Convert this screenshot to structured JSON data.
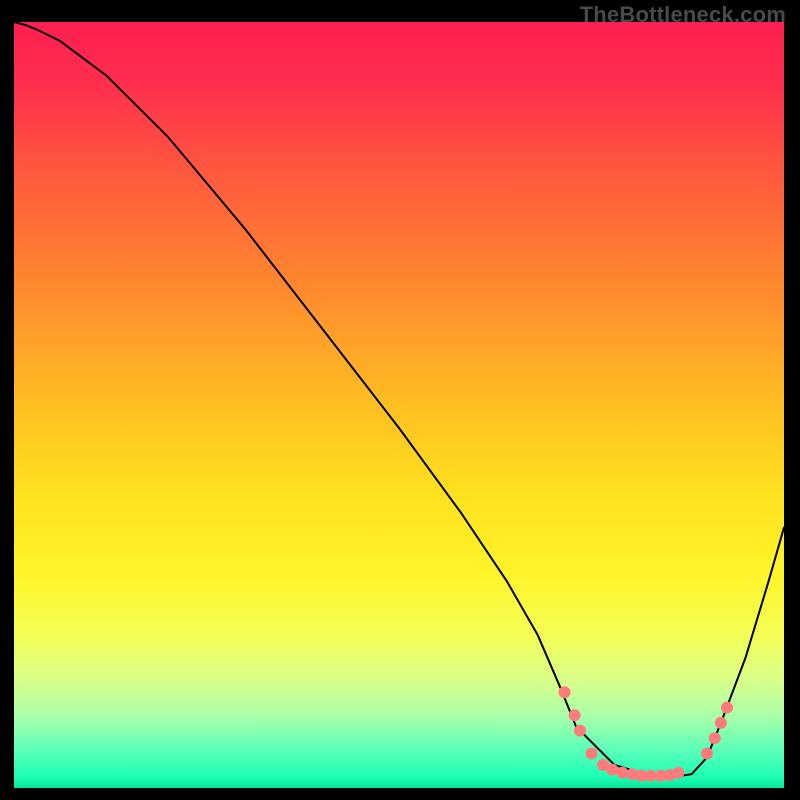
{
  "watermark": "TheBottleneck.com",
  "chart_data": {
    "type": "line",
    "title": "",
    "xlabel": "",
    "ylabel": "",
    "xlim": [
      0,
      100
    ],
    "ylim": [
      0,
      100
    ],
    "grid": false,
    "legend": false,
    "background": {
      "type": "vertical-gradient",
      "stops": [
        {
          "offset": 0,
          "color": "#ff1f52"
        },
        {
          "offset": 0.08,
          "color": "#ff2e4d"
        },
        {
          "offset": 0.2,
          "color": "#ff5a3d"
        },
        {
          "offset": 0.35,
          "color": "#ff8a2e"
        },
        {
          "offset": 0.5,
          "color": "#ffbf22"
        },
        {
          "offset": 0.63,
          "color": "#ffe41f"
        },
        {
          "offset": 0.72,
          "color": "#fff429"
        },
        {
          "offset": 0.8,
          "color": "#f4ff55"
        },
        {
          "offset": 0.86,
          "color": "#d9ff8a"
        },
        {
          "offset": 0.91,
          "color": "#a4ffab"
        },
        {
          "offset": 0.95,
          "color": "#5bffb8"
        },
        {
          "offset": 0.985,
          "color": "#1effb6"
        },
        {
          "offset": 1.0,
          "color": "#06e79a"
        }
      ]
    },
    "series": [
      {
        "name": "bottleneck-curve",
        "color": "#000000",
        "x": [
          0,
          1.5,
          3,
          6,
          12,
          20,
          30,
          40,
          50,
          58,
          64,
          68,
          71,
          73,
          78,
          83,
          86,
          88,
          90,
          92,
          95,
          98,
          100
        ],
        "y": [
          100,
          99.6,
          99,
          97.5,
          93,
          85,
          73,
          60,
          47,
          36,
          27,
          20,
          13,
          8,
          3,
          1.5,
          1.5,
          1.8,
          4,
          9,
          17,
          27,
          34
        ]
      }
    ],
    "markers": {
      "name": "threshold-dots",
      "color": "#ff7a7a",
      "radius": 6,
      "points_xy": [
        [
          71.5,
          12.5
        ],
        [
          72.8,
          9.5
        ],
        [
          73.5,
          7.5
        ],
        [
          75.0,
          4.5
        ],
        [
          76.5,
          3.0
        ],
        [
          77.7,
          2.4
        ],
        [
          79.0,
          2.0
        ],
        [
          80.3,
          1.8
        ],
        [
          81.5,
          1.6
        ],
        [
          82.7,
          1.6
        ],
        [
          84.0,
          1.6
        ],
        [
          85.2,
          1.7
        ],
        [
          86.3,
          2.0
        ],
        [
          90.0,
          4.5
        ],
        [
          91.0,
          6.5
        ],
        [
          91.8,
          8.5
        ],
        [
          92.6,
          10.5
        ]
      ]
    }
  }
}
